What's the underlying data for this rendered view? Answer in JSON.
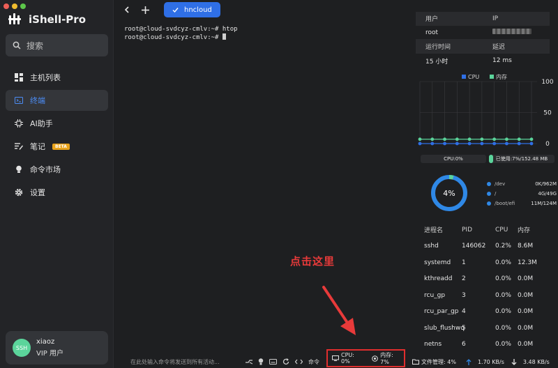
{
  "app": {
    "title": "iShell-Pro"
  },
  "sidebar": {
    "search_placeholder": "搜索",
    "items": [
      {
        "label": "主机列表",
        "icon": "grid-icon",
        "active": false
      },
      {
        "label": "终端",
        "icon": "terminal-icon",
        "active": true
      },
      {
        "label": "AI助手",
        "icon": "ai-chip-icon",
        "active": false
      },
      {
        "label": "笔记",
        "icon": "note-icon",
        "active": false,
        "badge": "BETA"
      },
      {
        "label": "命令市场",
        "icon": "lightbulb-icon",
        "active": false
      },
      {
        "label": "设置",
        "icon": "gear-icon",
        "active": false
      }
    ],
    "user": {
      "avatar": "SSH",
      "name": "xiaoz",
      "role": "VIP 用户"
    }
  },
  "tabs": [
    {
      "label": "hncloud",
      "active": true
    }
  ],
  "terminal": {
    "lines": [
      "root@cloud-svdcyz-cmlv:~# htop",
      "root@cloud-svdcyz-cmlv:~# "
    ]
  },
  "annotation": {
    "text": "点击这里"
  },
  "info": {
    "head1": [
      "用户",
      "IP"
    ],
    "row1": [
      "root",
      ""
    ],
    "head2": [
      "运行时间",
      "延迟"
    ],
    "row2": [
      "15 小时",
      "12 ms"
    ]
  },
  "chart_data": {
    "type": "line",
    "series": [
      {
        "name": "CPU",
        "color": "#2f6fe6",
        "values": [
          0,
          0,
          0,
          0,
          0,
          0,
          0,
          0,
          0,
          0
        ]
      },
      {
        "name": "内存",
        "color": "#5bd49b",
        "values": [
          7,
          7,
          7,
          7,
          7,
          7,
          7,
          7,
          7,
          7
        ]
      }
    ],
    "ylim": [
      0,
      100
    ],
    "yticks": [
      "100",
      "50",
      "0"
    ]
  },
  "resource": {
    "cpu_label": "CPU:0%",
    "mem_label": "已使用:7%/152.48 MB",
    "mem_fraction": 0.07,
    "disk_percent_label": "4%",
    "disk_fraction": 0.04,
    "disks": [
      {
        "path": "/dev",
        "size": "0K/962M"
      },
      {
        "path": "/",
        "size": "4G/49G"
      },
      {
        "path": "/boot/efi",
        "size": "11M/124M"
      }
    ]
  },
  "processes": {
    "headers": [
      "进程名",
      "PID",
      "CPU",
      "内存"
    ],
    "rows": [
      [
        "sshd",
        "146062",
        "0.2%",
        "8.6M"
      ],
      [
        "systemd",
        "1",
        "0.0%",
        "12.3M"
      ],
      [
        "kthreadd",
        "2",
        "0.0%",
        "0.0M"
      ],
      [
        "rcu_gp",
        "3",
        "0.0%",
        "0.0M"
      ],
      [
        "rcu_par_gp",
        "4",
        "0.0%",
        "0.0M"
      ],
      [
        "slub_flushwq",
        "5",
        "0.0%",
        "0.0M"
      ],
      [
        "netns",
        "6",
        "0.0%",
        "0.0M"
      ]
    ]
  },
  "statusbar": {
    "input_placeholder": "在此处输入命令将发送到所有活动...",
    "cmd_label": "命令",
    "cpu": "CPU: 0%",
    "mem": "内存: 7%",
    "files": "文件管理: 4%",
    "upload": "1.70 KB/s",
    "download": "3.48 KB/s"
  },
  "colors": {
    "accent": "#2f6fe6",
    "green": "#5bd49b",
    "annotation": "#e02e2e"
  }
}
